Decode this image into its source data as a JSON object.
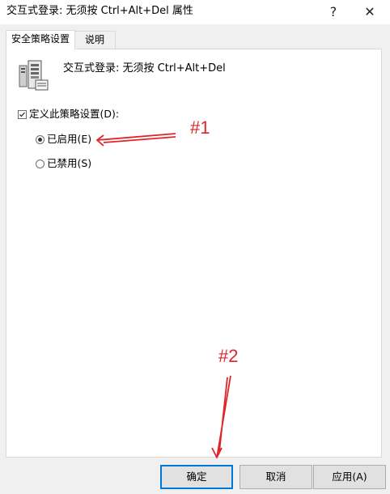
{
  "window": {
    "title": "交互式登录: 无须按 Ctrl+Alt+Del 属性",
    "help_glyph": "?",
    "close_glyph": "✕"
  },
  "tabs": [
    {
      "label": "安全策略设置",
      "active": true
    },
    {
      "label": "说明",
      "active": false
    }
  ],
  "policy": {
    "icon": "server-policy-icon",
    "name": "交互式登录: 无须按 Ctrl+Alt+Del",
    "define_label": "定义此策略设置(D):",
    "define_checked": true,
    "options": [
      {
        "label": "已启用(E)",
        "selected": true
      },
      {
        "label": "已禁用(S)",
        "selected": false
      }
    ]
  },
  "annotations": {
    "label1": "#1",
    "label2": "#2",
    "color": "#e0242a"
  },
  "buttons": {
    "ok": "确定",
    "cancel": "取消",
    "apply": "应用(A)"
  }
}
